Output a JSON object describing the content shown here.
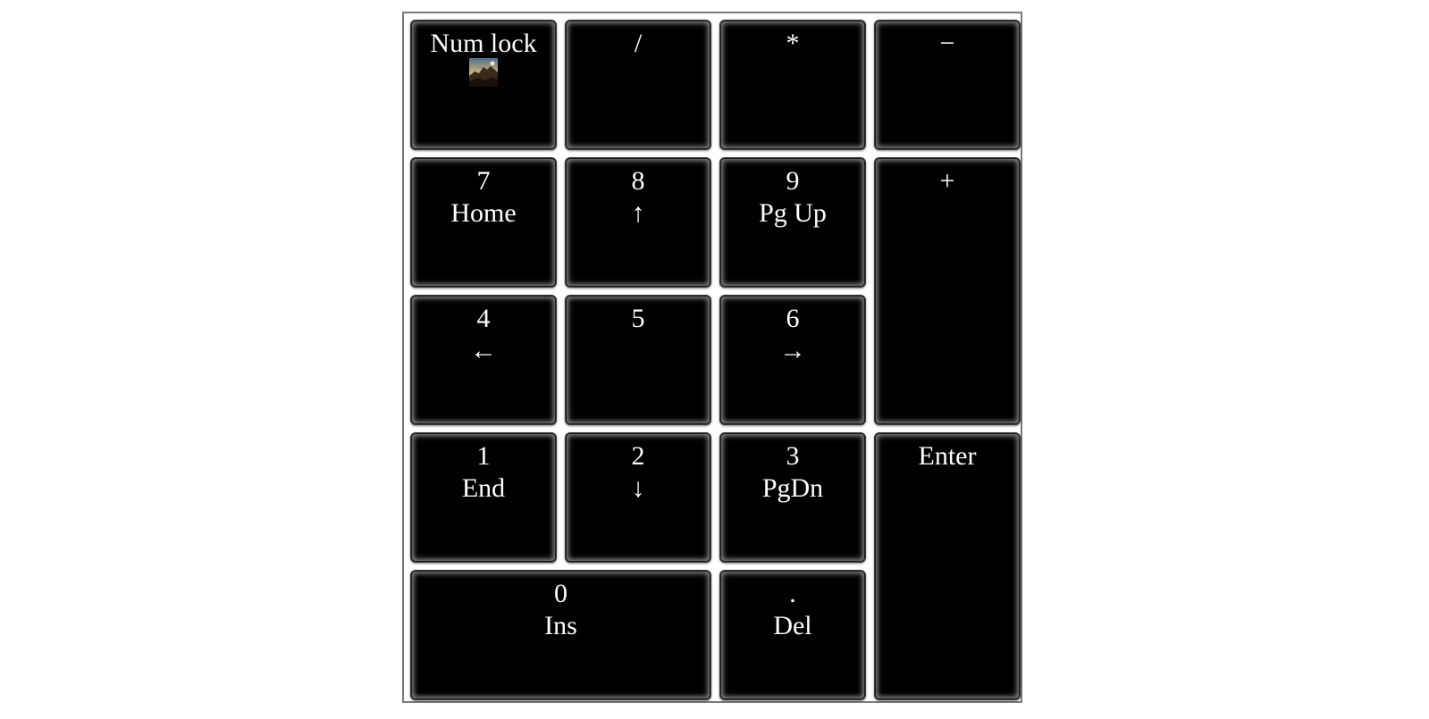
{
  "numpad": {
    "num_lock": {
      "label": "Num lock",
      "icon": "landscape-thumbnail-icon"
    },
    "divide": {
      "label": "/"
    },
    "multiply": {
      "label": "*"
    },
    "minus": {
      "label": "−"
    },
    "key_7": {
      "primary": "7",
      "secondary": "Home"
    },
    "key_8": {
      "primary": "8",
      "secondary": "↑"
    },
    "key_9": {
      "primary": "9",
      "secondary": "Pg Up"
    },
    "plus": {
      "label": "+"
    },
    "key_4": {
      "primary": "4",
      "secondary": "←"
    },
    "key_5": {
      "primary": "5"
    },
    "key_6": {
      "primary": "6",
      "secondary": "→"
    },
    "key_1": {
      "primary": "1",
      "secondary": "End"
    },
    "key_2": {
      "primary": "2",
      "secondary": "↓"
    },
    "key_3": {
      "primary": "3",
      "secondary": "PgDn"
    },
    "enter": {
      "label": "Enter"
    },
    "key_0": {
      "primary": "0",
      "secondary": "Ins"
    },
    "decimal": {
      "primary": ".",
      "secondary": "Del"
    }
  },
  "colors": {
    "key_background": "#000000",
    "key_text": "#ffffff",
    "frame_border": "#7a7a7a",
    "page_background": "#ffffff"
  }
}
